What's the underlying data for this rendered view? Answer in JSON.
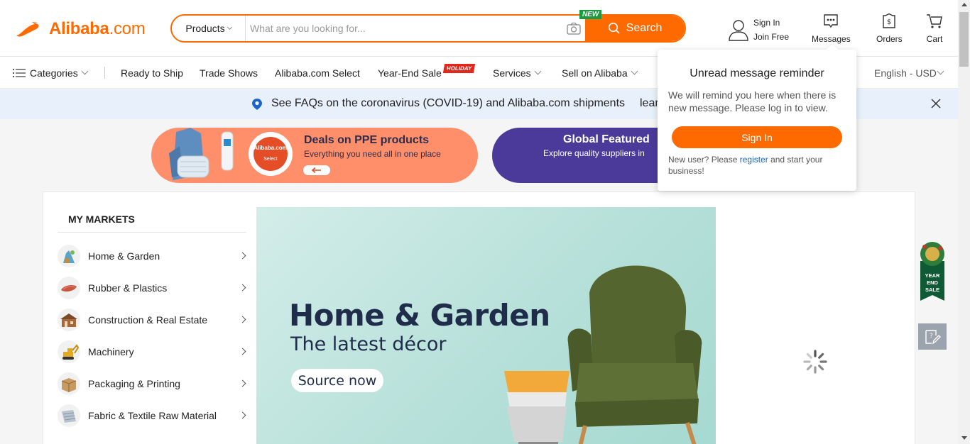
{
  "brand": {
    "logo_text": "Alibaba",
    "logo_suffix": ".com",
    "accent": "#ff6a00"
  },
  "search": {
    "category": "Products",
    "placeholder": "What are you looking for...",
    "button_label": "Search",
    "new_badge": "NEW"
  },
  "header": {
    "sign_in": "Sign In",
    "join_free": "Join Free",
    "messages": "Messages",
    "orders": "Orders",
    "cart": "Cart"
  },
  "nav": {
    "categories": "Categories",
    "items": [
      "Ready to Ship",
      "Trade Shows",
      "Alibaba.com Select",
      "Year-End Sale",
      "Services",
      "Sell on Alibaba"
    ],
    "holiday_badge": "HOLIDAY",
    "language": "English - USD"
  },
  "notice": {
    "text": "See FAQs on the coronavirus (COVID-19) and Alibaba.com shipments",
    "more": "lear"
  },
  "promos": [
    {
      "title": "Deals on PPE products",
      "subtitle": "Everything you need all in one place",
      "seal_top": "Alibaba.com",
      "seal_bottom": "Select"
    },
    {
      "title": "Global Featured",
      "subtitle": "Explore quality suppliers in"
    }
  ],
  "markets": {
    "title": "MY MARKETS",
    "items": [
      {
        "label": "Home & Garden",
        "icon": "home-garden-icon"
      },
      {
        "label": "Rubber & Plastics",
        "icon": "rubber-icon"
      },
      {
        "label": "Construction & Real Estate",
        "icon": "construction-icon"
      },
      {
        "label": "Machinery",
        "icon": "machinery-icon"
      },
      {
        "label": "Packaging & Printing",
        "icon": "packaging-icon"
      },
      {
        "label": "Fabric & Textile Raw Material",
        "icon": "fabric-icon"
      }
    ]
  },
  "banner": {
    "title": "Home & Garden",
    "subtitle": "The latest décor",
    "button": "Source now"
  },
  "popup": {
    "title": "Unread message reminder",
    "message": "We will remind you here when there is new message. Please log in to view.",
    "button": "Sign In",
    "foot_prefix": "New user? Please ",
    "foot_link": "register",
    "foot_suffix": " and start your business!"
  },
  "side_badge": {
    "line1": "YEAR",
    "line2": "END",
    "line3": "SALE"
  }
}
